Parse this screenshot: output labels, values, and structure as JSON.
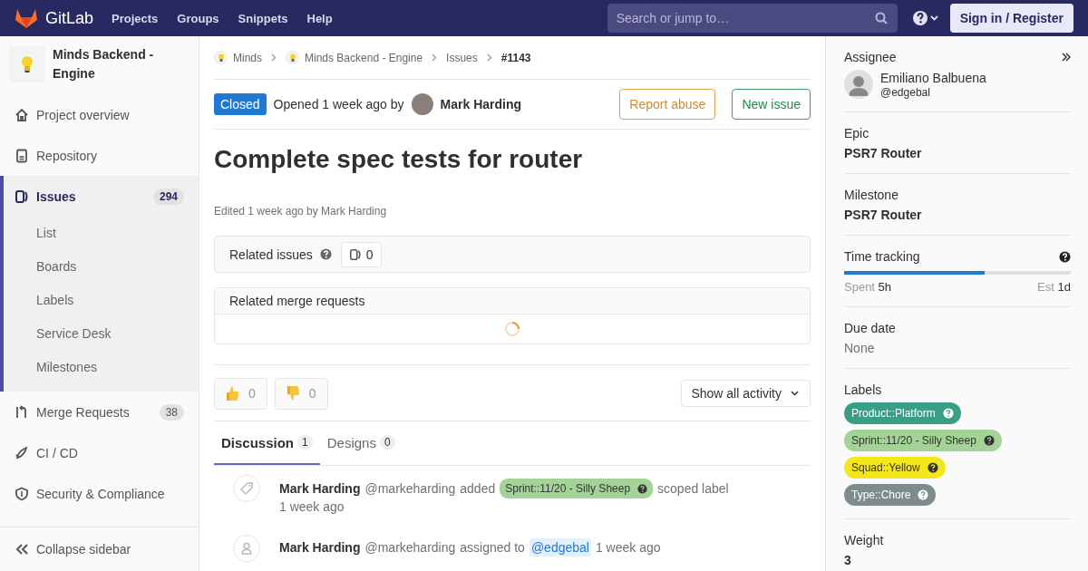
{
  "navbar": {
    "brand": "GitLab",
    "links": [
      "Projects",
      "Groups",
      "Snippets",
      "Help"
    ],
    "search": {
      "placeholder": "Search or jump to…"
    },
    "sign_in": "Sign in / Register"
  },
  "sidebar": {
    "project": "Minds Backend - Engine",
    "items": [
      {
        "kind": "overview",
        "label": "Project overview",
        "selected": false
      },
      {
        "kind": "repository",
        "label": "Repository",
        "selected": false
      },
      {
        "kind": "issues",
        "label": "Issues",
        "count": "294",
        "selected": true,
        "children": [
          {
            "label": "List"
          },
          {
            "label": "Boards"
          },
          {
            "label": "Labels"
          },
          {
            "label": "Service Desk"
          },
          {
            "label": "Milestones"
          }
        ]
      },
      {
        "kind": "merge",
        "label": "Merge Requests",
        "count": "38",
        "selected": false
      },
      {
        "kind": "cicd",
        "label": "CI / CD",
        "selected": false
      },
      {
        "kind": "security",
        "label": "Security & Compliance",
        "selected": false
      }
    ],
    "collapse": "Collapse sidebar"
  },
  "breadcrumbs": [
    {
      "kind": "project",
      "label": "Minds"
    },
    {
      "kind": "project",
      "label": "Minds Backend - Engine"
    },
    {
      "kind": "link",
      "label": "Issues"
    },
    {
      "kind": "current",
      "label": "#1143"
    }
  ],
  "issue": {
    "status": "Closed",
    "opened": "Opened 1 week ago by",
    "author": "Mark Harding",
    "buttons": [
      {
        "kind": "warning",
        "label": "Report abuse"
      },
      {
        "kind": "success",
        "label": "New issue"
      }
    ],
    "title": "Complete spec tests for router",
    "edited": "Edited 1 week ago by Mark Harding"
  },
  "related_issues": {
    "label": "Related issues",
    "count": "0"
  },
  "related_merge_requests": {
    "label": "Related merge requests",
    "loading": true
  },
  "awards": [
    {
      "kind": "thumbsup",
      "count": "0"
    },
    {
      "kind": "thumbsdown",
      "count": "0"
    }
  ],
  "activity_filter": "Show all activity",
  "tabs": [
    {
      "label": "Discussion",
      "count": "1",
      "selected": true
    },
    {
      "label": "Designs",
      "count": "0",
      "selected": false
    }
  ],
  "notes": [
    {
      "kind": "label",
      "author": "Mark Harding",
      "username": "@markeharding",
      "action": "added",
      "label": {
        "text": "Sprint::11/20 - Silly Sheep",
        "color": "#a3d396"
      },
      "suffix": "scoped label",
      "time": "1 week ago"
    },
    {
      "kind": "assign",
      "author": "Mark Harding",
      "username": "@markeharding",
      "action": "assigned to",
      "mention": "@edgebal",
      "time": "1 week ago"
    }
  ],
  "right_sidebar": {
    "assignee": {
      "heading": "Assignee",
      "name": "Emiliano Balbuena",
      "username": "@edgebal"
    },
    "epic": {
      "heading": "Epic",
      "value": "PSR7 Router"
    },
    "milestone": {
      "heading": "Milestone",
      "value": "PSR7 Router"
    },
    "time_tracking": {
      "heading": "Time tracking",
      "level": 0.62,
      "spent_label": "Spent",
      "spent": "5h",
      "est_label": "Est",
      "est": "1d"
    },
    "due_date": {
      "heading": "Due date",
      "value": "None"
    },
    "labels": {
      "heading": "Labels",
      "items": [
        {
          "text": "Product::Platform",
          "color": "#3a9d85"
        },
        {
          "text": "Sprint::11/20 - Silly Sheep",
          "color": "#a3d396"
        },
        {
          "text": "Squad::Yellow",
          "color": "#f5e51b"
        },
        {
          "text": "Type::Chore",
          "color": "#7f8c8d"
        }
      ]
    },
    "weight": {
      "heading": "Weight",
      "value": "3"
    }
  }
}
